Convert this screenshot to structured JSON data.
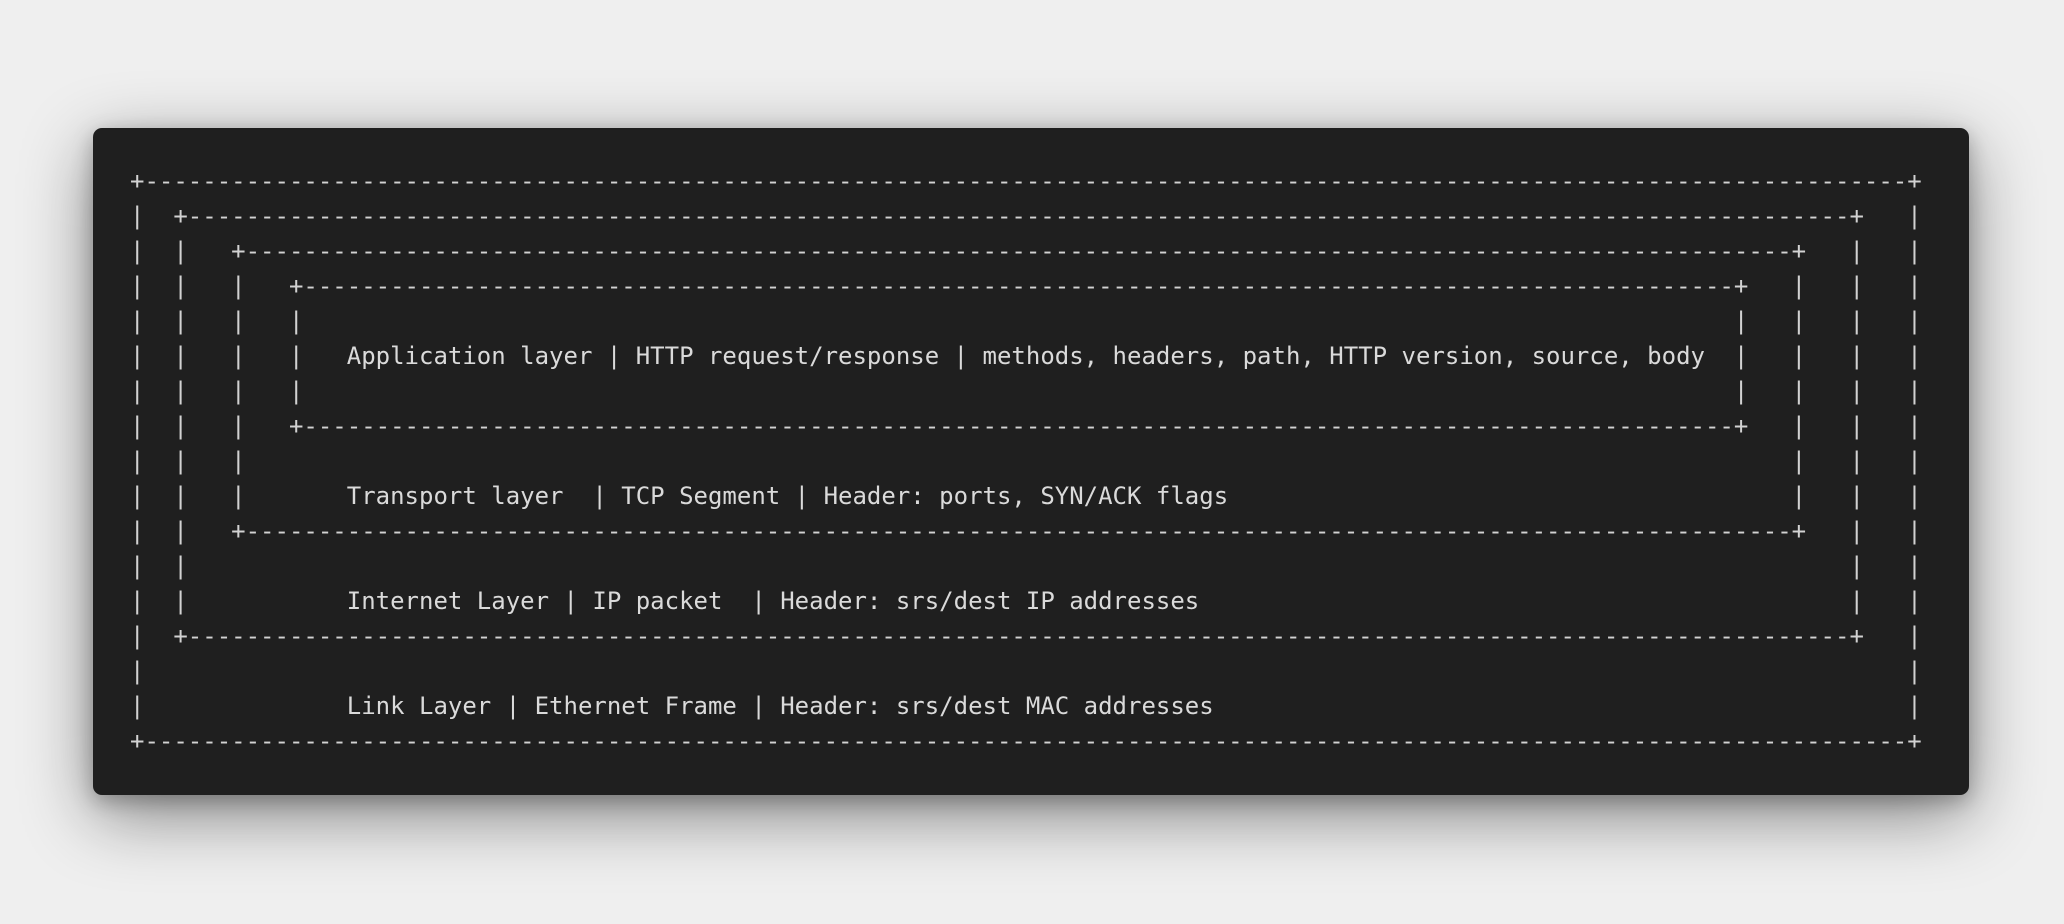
{
  "diagram": {
    "layers": [
      {
        "id": "application",
        "text": "Application layer | HTTP request/response | methods, headers, path, HTTP version, source, body"
      },
      {
        "id": "transport",
        "text": "Transport layer  | TCP Segment | Header: ports, SYN/ACK flags"
      },
      {
        "id": "internet",
        "text": "Internet Layer | IP packet  | Header: srs/dest IP addresses"
      },
      {
        "id": "link",
        "text": "Link Layer | Ethernet Frame | Header: srs/dest MAC addresses"
      }
    ],
    "colors": {
      "background": "#1f1f1f",
      "text": "#d2d2d2",
      "page": "#efefef"
    }
  }
}
